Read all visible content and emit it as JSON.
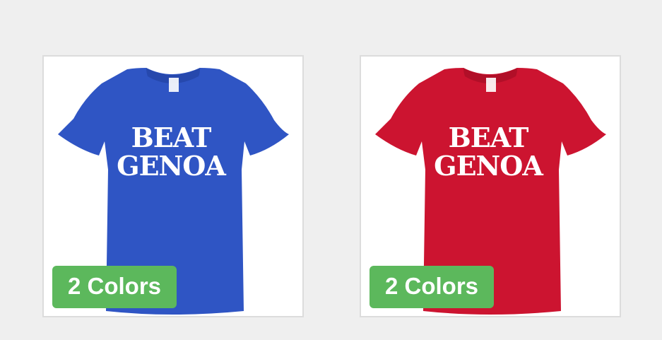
{
  "products": [
    {
      "shirt_color": "#2f55c4",
      "shirt_shade": "#2648ad",
      "print_line1": "BEAT",
      "print_line2": "GENOA",
      "badge_label": "2 Colors",
      "badge_color": "#5cb85c"
    },
    {
      "shirt_color": "#cc1430",
      "shirt_shade": "#b10f28",
      "print_line1": "BEAT",
      "print_line2": "GENOA",
      "badge_label": "2 Colors",
      "badge_color": "#5cb85c"
    }
  ]
}
